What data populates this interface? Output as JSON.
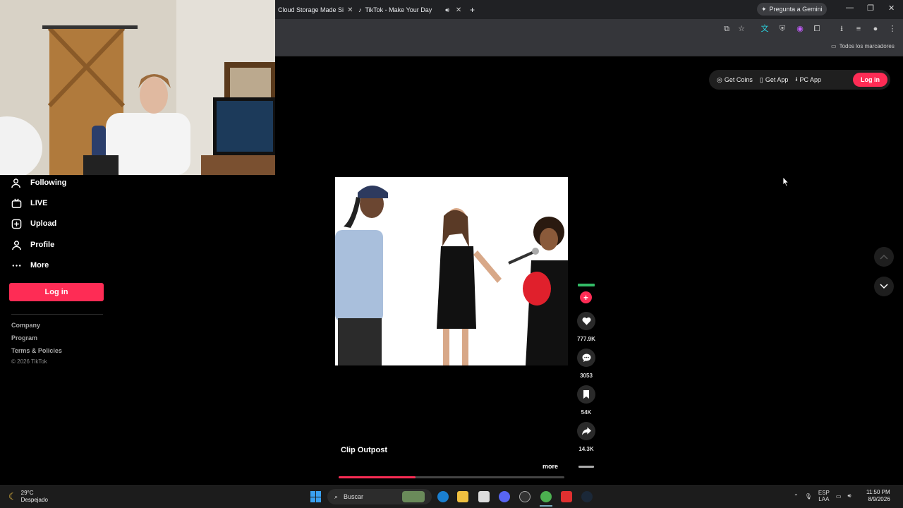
{
  "browser": {
    "tabs": [
      {
        "label": "Cloud Storage Made Si"
      },
      {
        "label": "TikTok - Make Your Day"
      }
    ],
    "gemini_label": "Pregunta a Gemini",
    "bookmarks_label": "Todos los marcadores"
  },
  "sidebar": {
    "items": [
      {
        "label": "Following",
        "icon": "user-follow-icon"
      },
      {
        "label": "LIVE",
        "icon": "live-tv-icon"
      },
      {
        "label": "Upload",
        "icon": "plus-square-icon"
      },
      {
        "label": "Profile",
        "icon": "profile-icon"
      },
      {
        "label": "More",
        "icon": "more-dots-icon"
      }
    ],
    "login_label": "Log in",
    "links": [
      "Company",
      "Program",
      "Terms & Policies"
    ],
    "copyright": "© 2026 TikTok"
  },
  "top_actions": {
    "get_coins": "Get Coins",
    "get_app": "Get App",
    "pc_app": "PC App",
    "login": "Log in"
  },
  "video": {
    "author": "Clip Outpost",
    "more_label": "more",
    "progress": 0.34,
    "likes": "777.9K",
    "comments": "3053",
    "saves": "54K",
    "shares": "14.3K"
  },
  "taskbar": {
    "temperature": "29°C",
    "weather": "Despejado",
    "search_placeholder": "Buscar",
    "lang_top": "ESP",
    "lang_bottom": "LAA",
    "time": "11:50 PM",
    "date": "8/9/2026"
  },
  "colors": {
    "accent": "#fe2c55",
    "background": "#000000",
    "chrome": "#35363a"
  }
}
